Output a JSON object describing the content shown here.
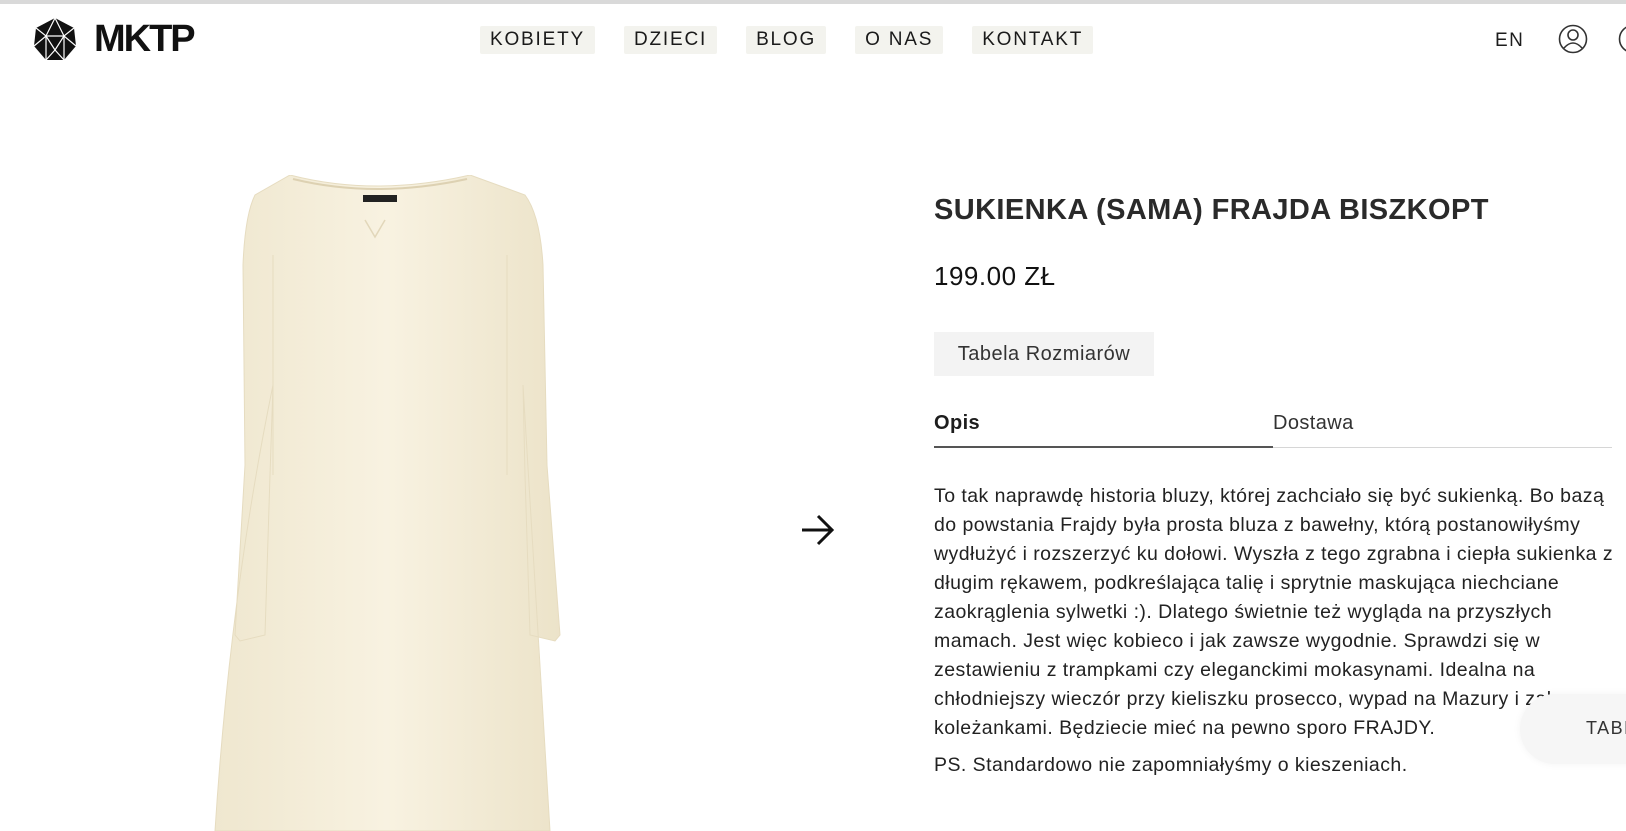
{
  "header": {
    "logo_text": "MKTP",
    "nav": [
      "KOBIETY",
      "DZIECI",
      "BLOG",
      "O NAS",
      "KONTAKT"
    ],
    "lang": "EN"
  },
  "product": {
    "title": "SUKIENKA (SAMA) FRAJDA BISZKOPT",
    "price": "199.00 ZŁ",
    "size_button": "Tabela Rozmiarów",
    "image_color": "#f5efdc"
  },
  "tabs": {
    "opis": "Opis",
    "dostawa": "Dostawa"
  },
  "description": {
    "p1": "To tak naprawdę historia bluzy, której zachciało się być sukienką. Bo bazą do powstania Frajdy była prosta bluza z bawełny, którą postanowiłyśmy wydłużyć i rozszerzyć ku dołowi. Wyszła z tego zgrabna i ciepła sukienka z długim rękawem, podkreślająca talię i sprytnie maskująca niechciane zaokrąglenia sylwetki :). Dlatego świetnie też wygląda na przyszłych mamach. Jest więc kobieco i jak zawsze wygodnie. Sprawdzi się w zestawieniu z trampkami czy eleganckimi mokasynami. Idealna na chłodniejszy wieczór przy kieliszku prosecco, wypad na Mazury i zakupy z koleżankami. Będziecie mieć na pewno sporo FRAJDY.",
    "p2": "PS. Standardowo nie zapomniałyśmy o kieszeniach."
  },
  "float_tab": "TABELA"
}
